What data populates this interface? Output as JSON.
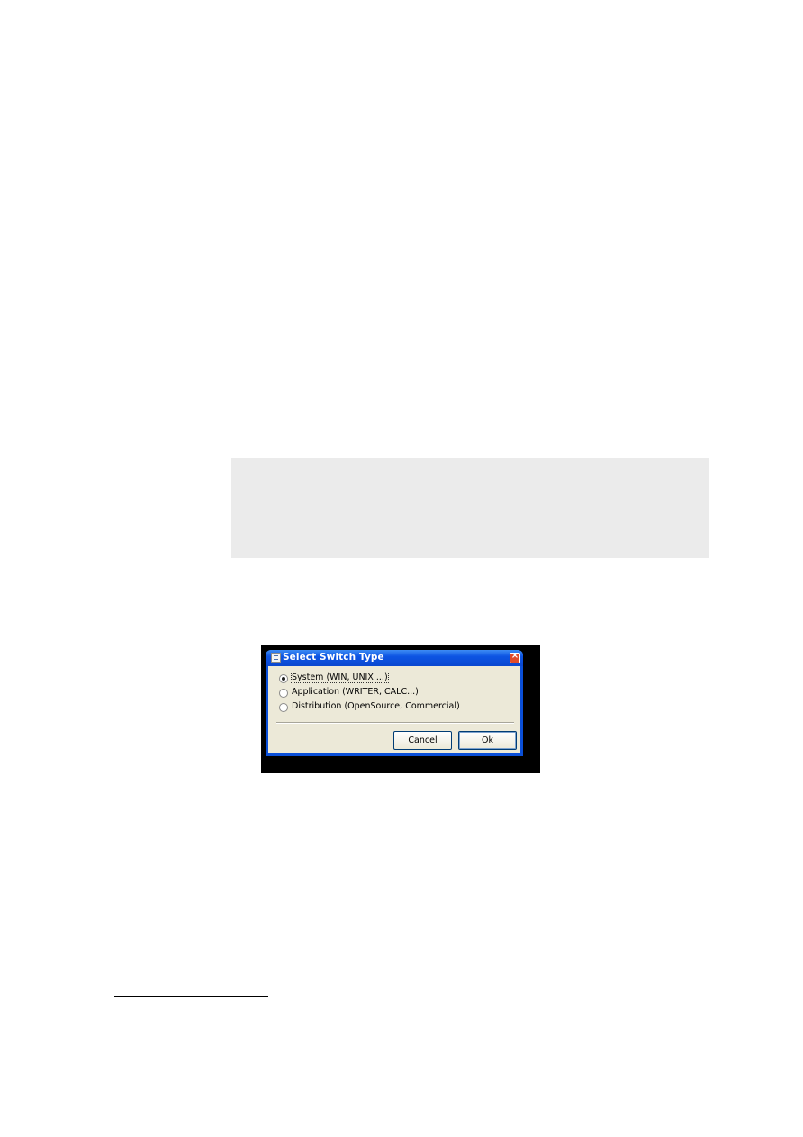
{
  "dialog": {
    "title": "Select Switch Type",
    "icon": "app-icon",
    "close_icon": "close-icon",
    "close_label": "×",
    "options": [
      {
        "label": "System (WIN, UNIX ...)",
        "selected": true
      },
      {
        "label": "Application (WRITER, CALC...)",
        "selected": false
      },
      {
        "label": "Distribution (OpenSource, Commercial)",
        "selected": false
      }
    ],
    "cancel_label": "Cancel",
    "ok_label": "Ok"
  },
  "colors": {
    "title_bar": "#0a4fd8",
    "dialog_background": "#ece9d8",
    "gray_box": "#ebebeb",
    "close_button": "#df4a2a"
  }
}
